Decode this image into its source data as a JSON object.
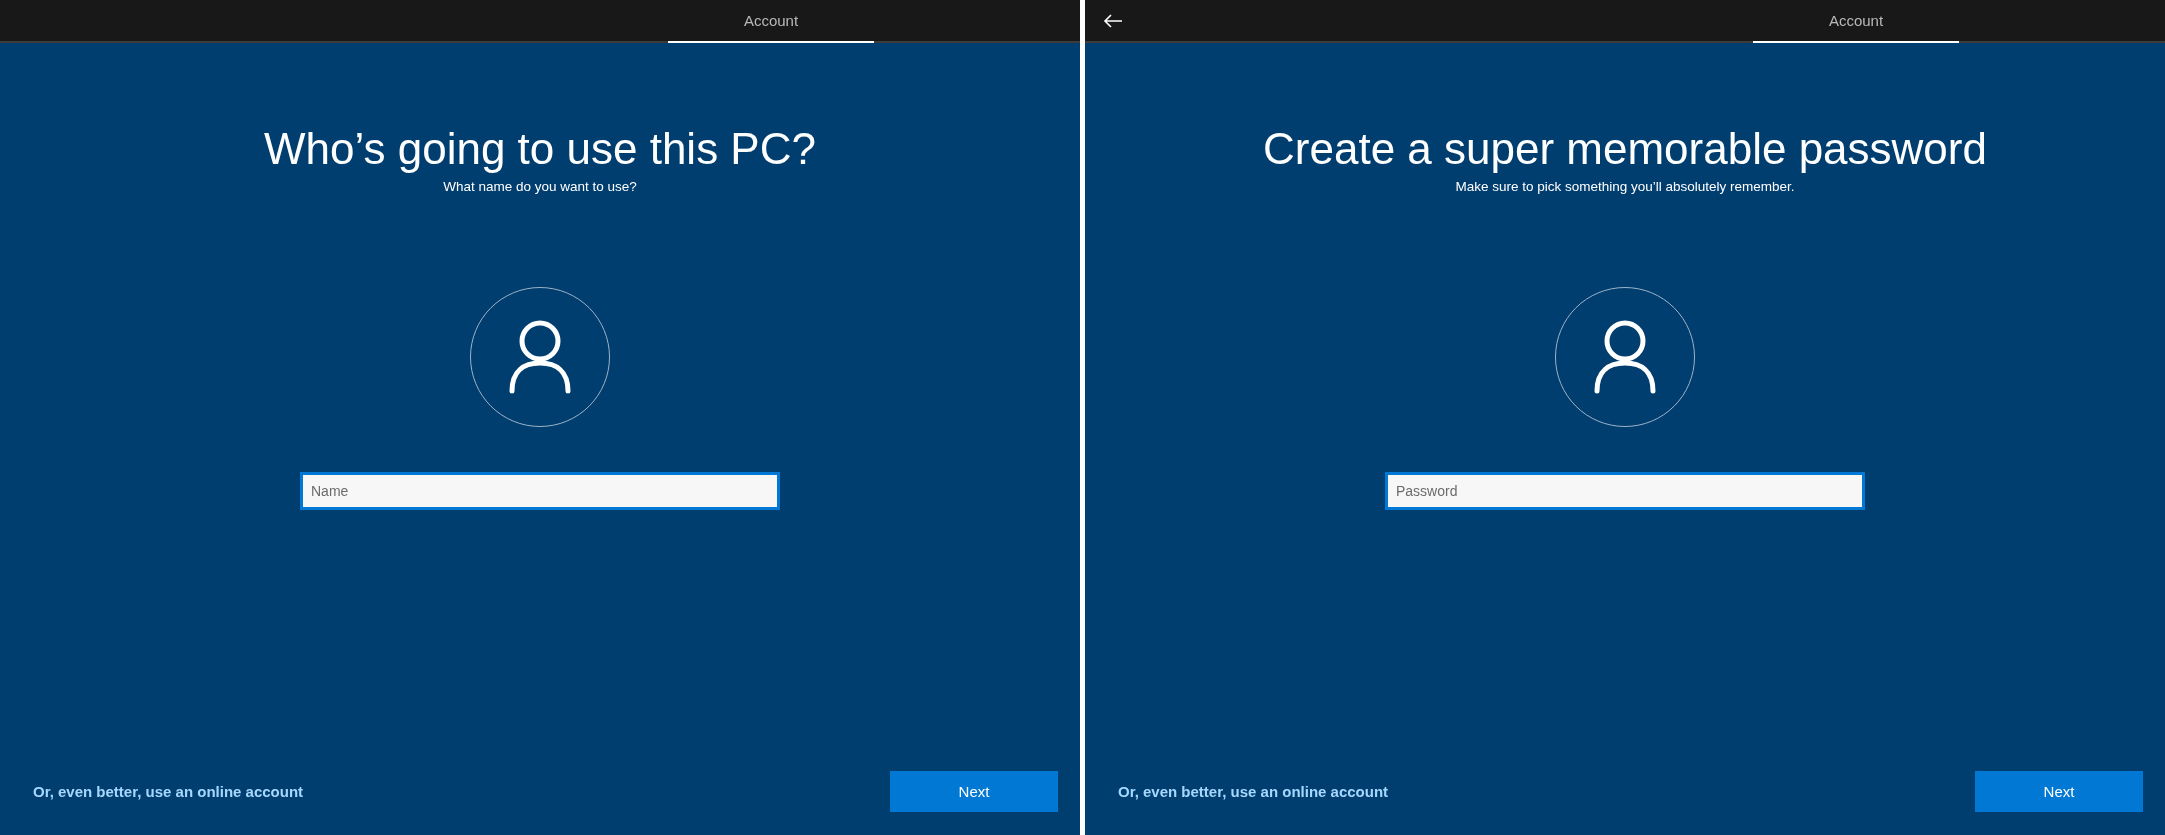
{
  "panels": [
    {
      "back_button": false,
      "tab": {
        "label": "Account",
        "selected": true
      },
      "title": "Who’s going to use this PC?",
      "subtitle": "What name do you want to use?",
      "field": {
        "placeholder": "Name"
      },
      "link": "Or, even better, use an online account",
      "button": "Next"
    },
    {
      "back_button": true,
      "tab": {
        "label": "Account",
        "selected": true
      },
      "title": "Create a super memorable password",
      "subtitle": "Make sure to pick something you’ll absolutely remember.",
      "field": {
        "placeholder": "Password"
      },
      "link": "Or, even better, use an online account",
      "button": "Next"
    }
  ]
}
